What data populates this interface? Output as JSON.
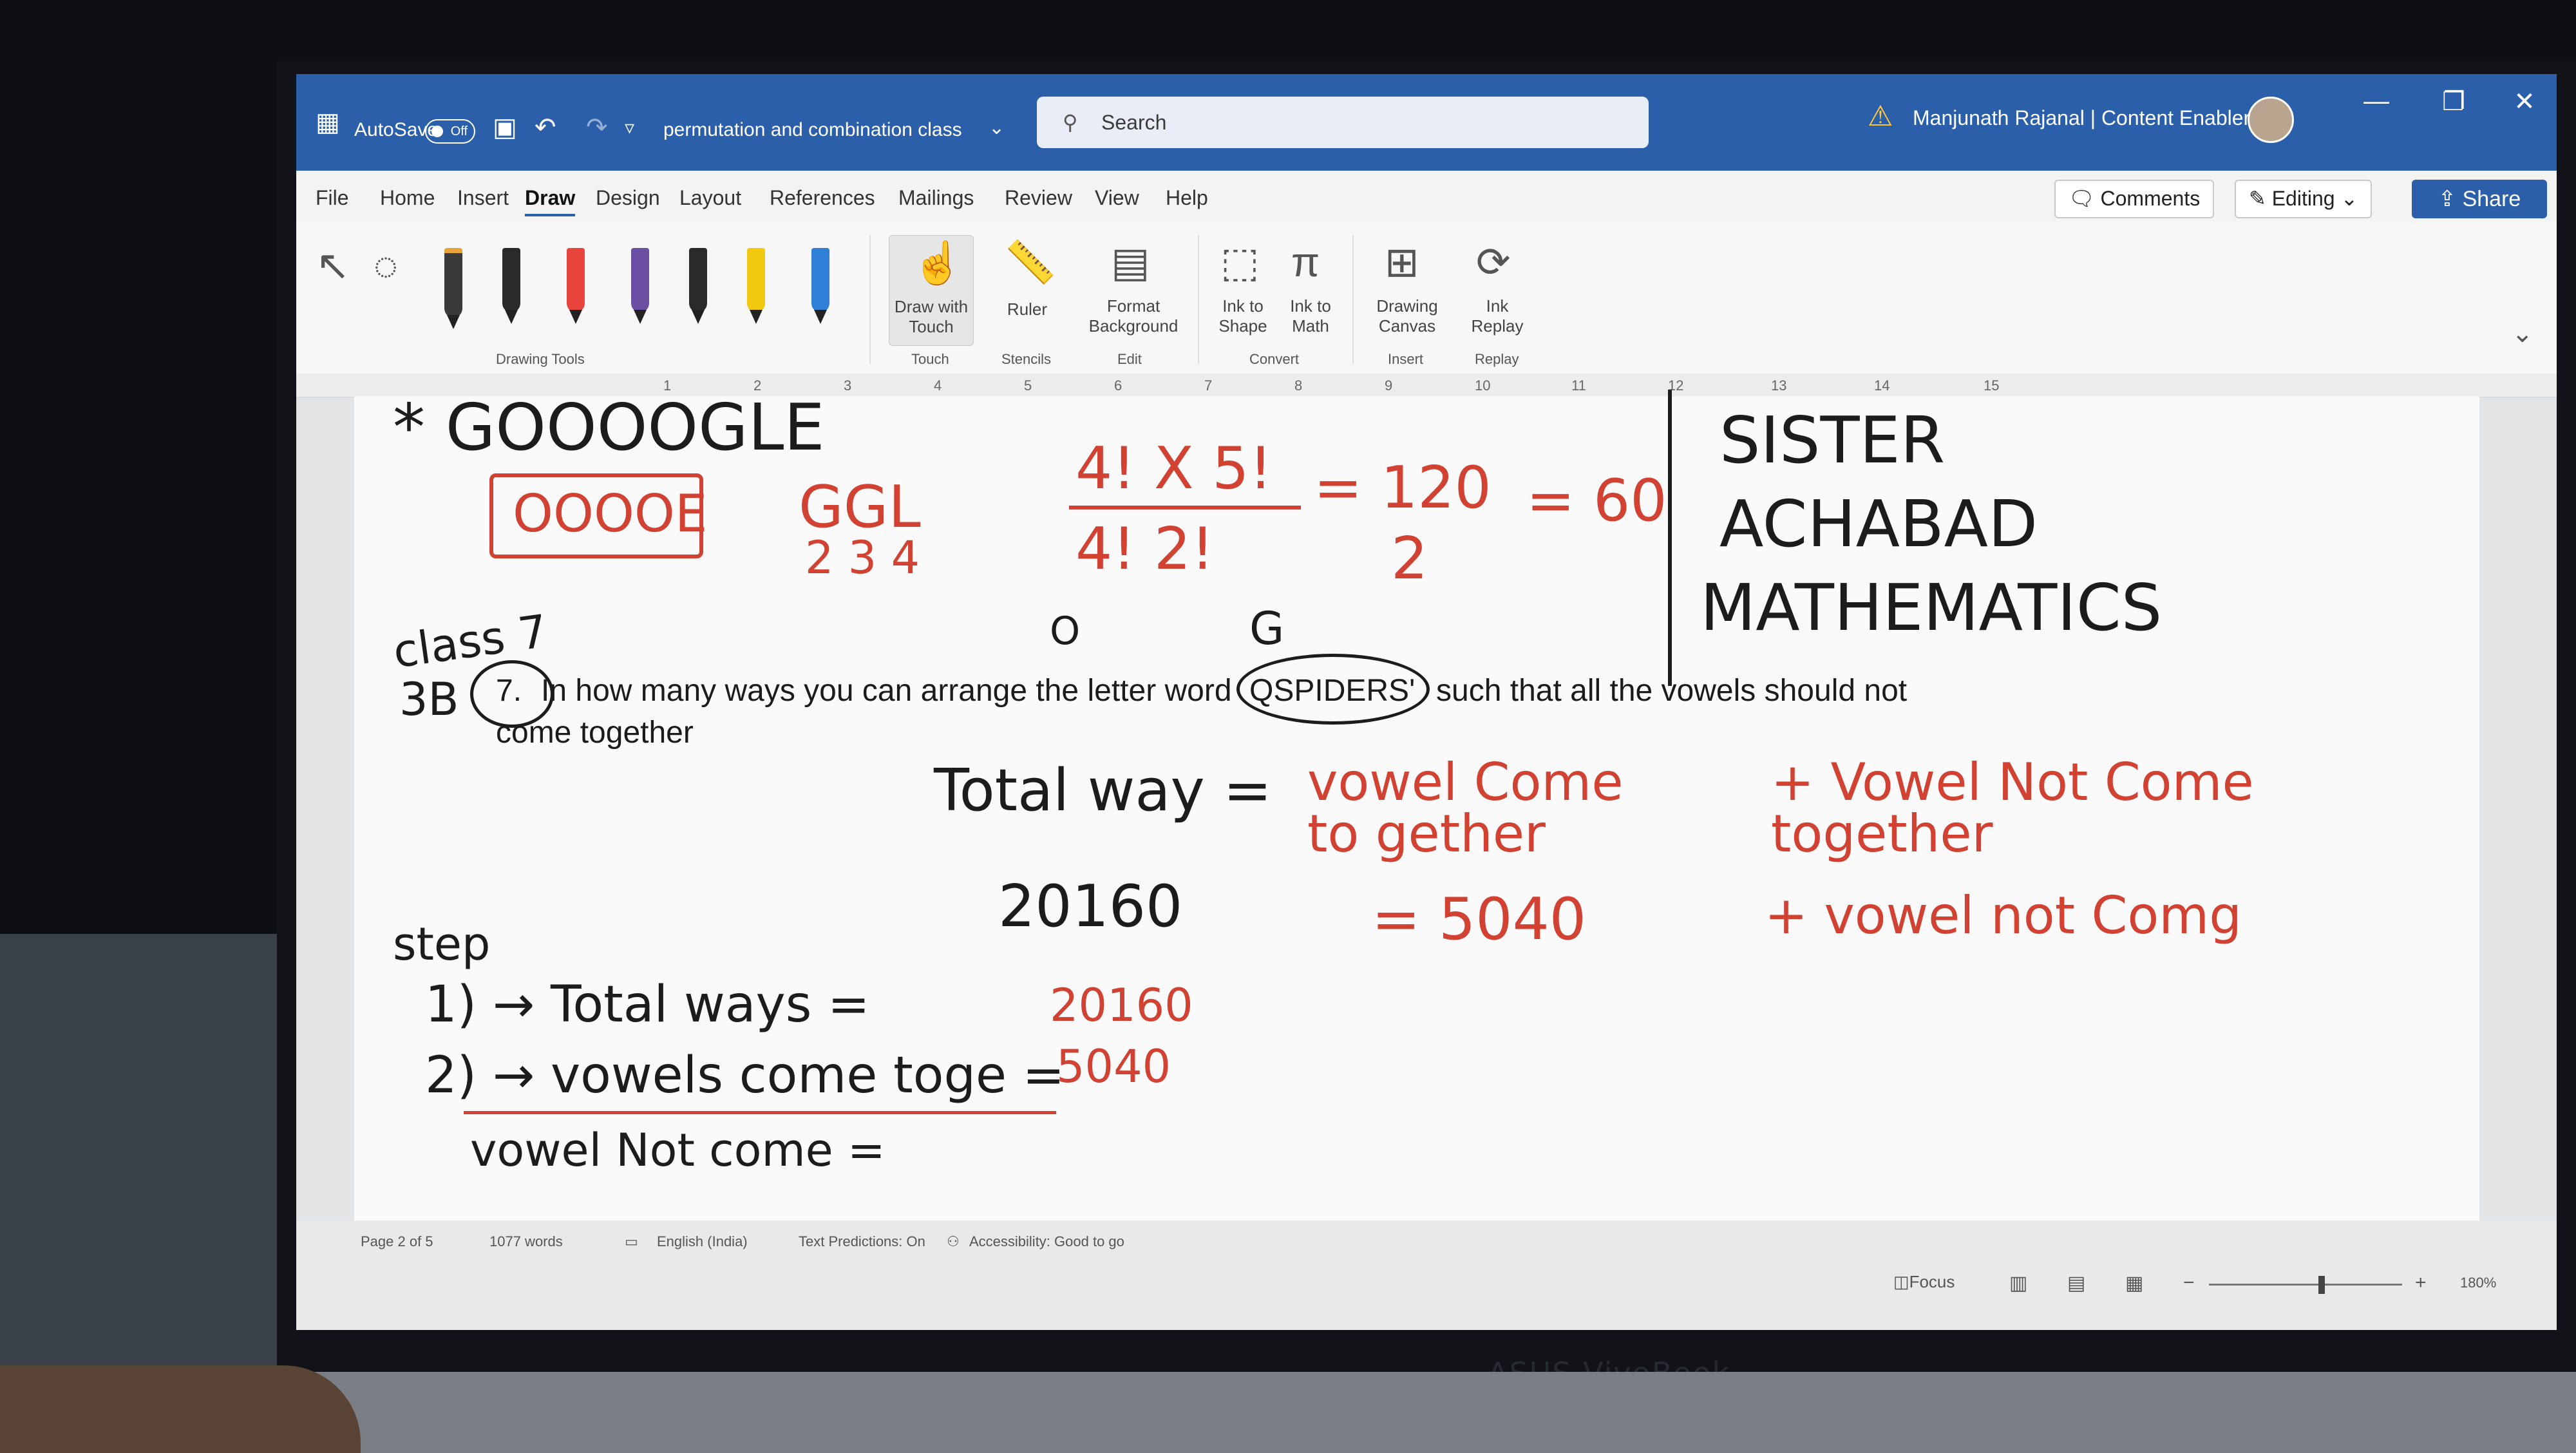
{
  "titlebar": {
    "autosave_label": "AutoSave",
    "autosave_state": "Off",
    "doc_title": "permutation and combination class",
    "search_placeholder": "Search",
    "user_name": "Manjunath Rajanal | Content Enablers"
  },
  "menu": {
    "tabs": [
      "File",
      "Home",
      "Insert",
      "Draw",
      "Design",
      "Layout",
      "References",
      "Mailings",
      "Review",
      "View",
      "Help"
    ],
    "active_tab": "Draw",
    "comments_label": "Comments",
    "editing_label": "Editing",
    "share_label": "Share"
  },
  "ribbon": {
    "drawing_tools_label": "Drawing Tools",
    "draw_with_touch": "Draw with Touch",
    "ruler": "Ruler",
    "format_background": "Format Background",
    "ink_to_shape": "Ink to Shape",
    "ink_to_math": "Ink to Math",
    "drawing_canvas": "Drawing Canvas",
    "ink_replay": "Ink Replay",
    "groups": {
      "touch": "Touch",
      "stencils": "Stencils",
      "edit": "Edit",
      "convert": "Convert",
      "insert": "Insert",
      "replay": "Replay"
    },
    "pen_colors": [
      "#2a2a2a",
      "#e8453c",
      "#6b4fa3",
      "#2a2a2a",
      "#f2c811",
      "#2f7fd6"
    ]
  },
  "ruler_ticks": [
    "1",
    "2",
    "3",
    "4",
    "5",
    "6",
    "7",
    "8",
    "9",
    "10",
    "11",
    "12",
    "13",
    "14",
    "15"
  ],
  "document": {
    "question_number": "7.",
    "question_text": "In how many ways you can arrange the letter word",
    "question_word": "QSPIDERS'",
    "question_text_tail": "such that all the vowels should not",
    "question_text_line2": "come together",
    "ink": {
      "google": "* GOOOOGLE",
      "ooooe": "OOOOE",
      "ggl": "GGL",
      "nums_234": "2 3 4",
      "frac_top": "4! X 5!",
      "frac_bottom": "4! 2!",
      "eq_120": "= 120",
      "eq_2": "2",
      "eq_60": "= 60",
      "o_label": "O",
      "g_label": "G",
      "class_label": "class 7",
      "class_3b": "3B",
      "sister": "SISTER",
      "achabad": "ACHABAD",
      "mathematics": "MATHEMATICS",
      "total_way": "Total way =",
      "vowel_come_together": "vowel Come to gether",
      "vowel_not_come_together": "+ Vowel Not Come together",
      "n20160": "20160",
      "eq_5040": "= 5040",
      "plus_vowel_not_come": "+ vowel not Comg",
      "step": "step",
      "step1": "1) → Total ways =",
      "step1_val": "20160",
      "step2": "2) → vowels come toge =",
      "step2_val": "5040",
      "step3": "vowel Not come ="
    }
  },
  "statusbar": {
    "page": "Page 2 of 5",
    "words": "1077 words",
    "language": "English (India)",
    "text_predictions": "Text Predictions: On",
    "accessibility": "Accessibility: Good to go",
    "focus": "Focus",
    "zoom": "180%"
  },
  "bezel": {
    "brand": "ASUS VivoBook"
  }
}
